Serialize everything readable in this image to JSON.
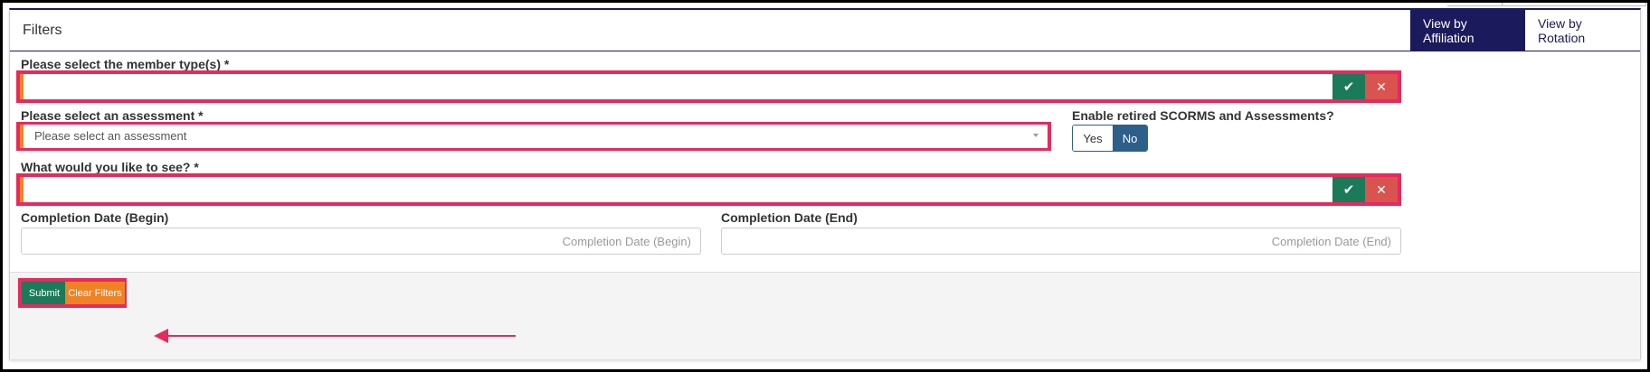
{
  "panel": {
    "title": "Filters",
    "view_tabs": [
      {
        "label": "View by Affiliation",
        "active": true
      },
      {
        "label": "View by Rotation",
        "active": false
      }
    ]
  },
  "member_types": {
    "label": "Please select the member type(s) *",
    "value": "",
    "confirm_icon": "check-icon",
    "clear_icon": "close-icon"
  },
  "assessment": {
    "label": "Please select an assessment *",
    "placeholder": "Please select an assessment",
    "caret_icon": "caret-down-icon"
  },
  "retired": {
    "label": "Enable retired SCORMS and Assessments?",
    "options": [
      "Yes",
      "No"
    ],
    "selected": "No"
  },
  "what_to_see": {
    "label": "What would you like to see? *",
    "value": "",
    "confirm_icon": "check-icon",
    "clear_icon": "close-icon"
  },
  "completion_begin": {
    "label": "Completion Date (Begin)",
    "placeholder": "Completion Date (Begin)"
  },
  "completion_end": {
    "label": "Completion Date (End)",
    "placeholder": "Completion Date (End)"
  },
  "footer": {
    "submit_label": "Submit",
    "clear_label": "Clear Filters"
  },
  "colors": {
    "primary": "#1b1a5c",
    "success": "#1b7a5a",
    "danger": "#d9534f",
    "warning": "#f08226",
    "highlight": "#e8295b",
    "toggle_active": "#2c5f8a"
  }
}
